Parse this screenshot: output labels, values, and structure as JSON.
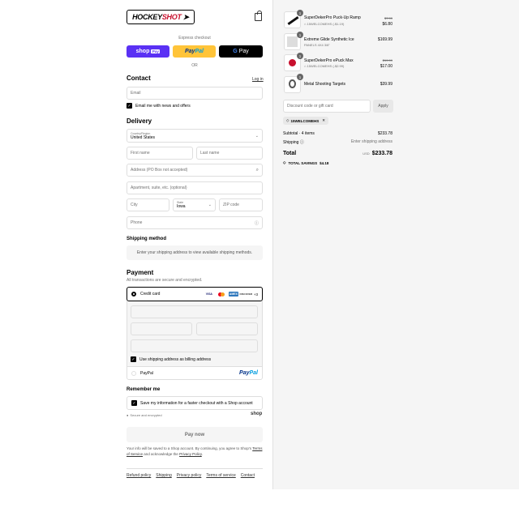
{
  "header": {
    "logo_text_1": "HOCKEY",
    "logo_text_2": "SHOT",
    "cart_icon": "shopping-bag-icon"
  },
  "express": {
    "title": "Express checkout",
    "shop_label": "shop",
    "shop_pay": "Pay",
    "paypal_1": "Pay",
    "paypal_2": "Pal",
    "gpay_g": "G",
    "gpay_label": "Pay",
    "or": "OR"
  },
  "contact": {
    "title": "Contact",
    "login": "Log in",
    "email_placeholder": "Email",
    "newsletter": "Email me with news and offers"
  },
  "delivery": {
    "title": "Delivery",
    "country_label": "Country/Region",
    "country_value": "United States",
    "first_name": "First name",
    "last_name": "Last name",
    "address": "Address (PO Box not accepted)",
    "apartment": "Apartment, suite, etc. (optional)",
    "city": "City",
    "state_label": "State",
    "state_value": "Iowa",
    "zip": "ZIP code",
    "phone": "Phone"
  },
  "shipping": {
    "title": "Shipping method",
    "notice": "Enter your shipping address to view available shipping methods."
  },
  "payment": {
    "title": "Payment",
    "subtitle": "All transactions are secure and encrypted.",
    "credit_card": "Credit card",
    "visa": "VISA",
    "amex": "AMEX",
    "discover": "DISCOVER",
    "more": "+3",
    "billing": "Use shipping address as billing address",
    "paypal": "PayPal",
    "paypal_logo_1": "Pay",
    "paypal_logo_2": "Pal"
  },
  "remember": {
    "title": "Remember me",
    "save_info": "Save my information for a faster checkout with a Shop account",
    "secure": "Secure and encrypted",
    "shop": "shop"
  },
  "pay_button": "Pay now",
  "legal": {
    "text_1": "Your info will be saved to a Shop account. By continuing, you agree to Shop's",
    "terms": "Terms of Service",
    "text_2": "and acknowledge the",
    "privacy": "Privacy Policy",
    "text_3": "."
  },
  "footer": {
    "links": [
      "Refund policy",
      "Shipping",
      "Privacy policy",
      "Terms of service",
      "Contact"
    ]
  },
  "cart": {
    "items": [
      {
        "qty": "1",
        "name": "SuperDekerPro Puck-Up Ramp",
        "discount": "15WELCOMEHS (-$1.19)",
        "old_price": "$7.99",
        "price": "$6.80"
      },
      {
        "qty": "1",
        "name": "Extreme Glide Synthetic Ice",
        "variant": "PANELS 4X4 3/8\"",
        "price": "$169.99"
      },
      {
        "qty": "1",
        "name": "SuperDekerPro ePuck Max",
        "discount": "15WELCOMEHS (-$2.99)",
        "old_price": "$19.99",
        "price": "$17.00"
      },
      {
        "qty": "1",
        "name": "Metal Shooting Targets",
        "price": "$39.99"
      }
    ],
    "discount_placeholder": "Discount code or gift card",
    "apply": "Apply",
    "applied_code": "15WELCOMEHS",
    "subtotal_label": "Subtotal · 4 items",
    "subtotal": "$233.78",
    "shipping_label": "Shipping",
    "shipping_value": "Enter shipping address",
    "total_label": "Total",
    "currency": "USD",
    "total": "$233.78",
    "savings_label": "TOTAL SAVINGS",
    "savings": "$4.18"
  }
}
